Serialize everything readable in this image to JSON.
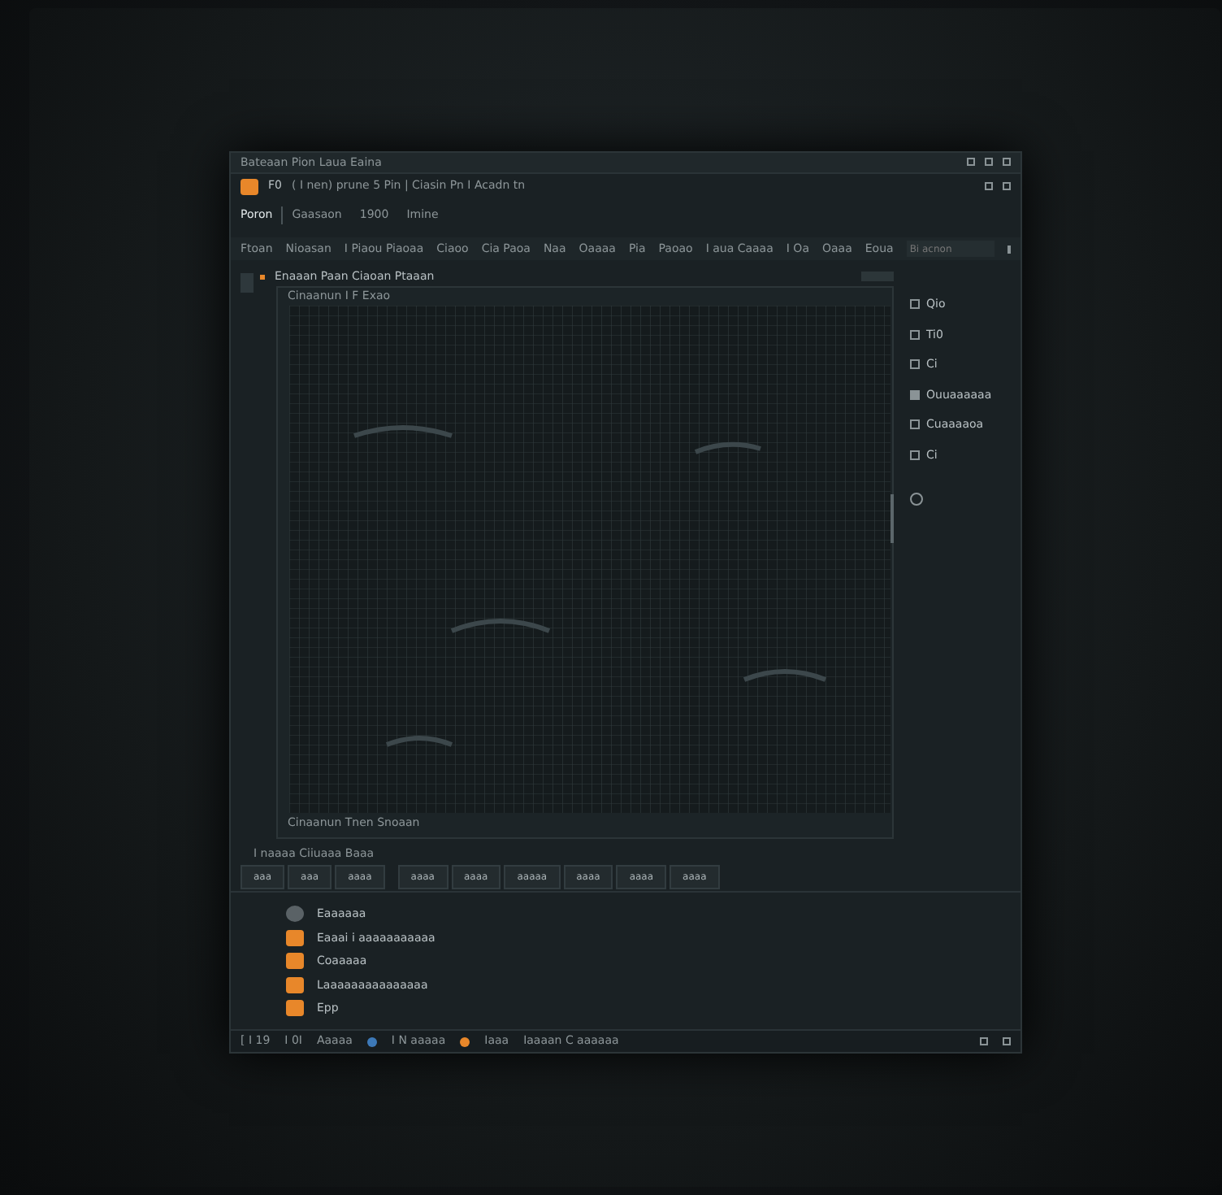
{
  "window": {
    "title": "Bateaan Pion Laua Eaina"
  },
  "toolbar": {
    "app_label": "F0",
    "path": "( I nen) prune 5 Pin | Ciasin Pn I Acadn tn"
  },
  "menu": [
    {
      "label": "Poron",
      "selected": true
    },
    {
      "label": "Gaasaon",
      "selected": false
    },
    {
      "label": "1900",
      "selected": false
    },
    {
      "label": "Imine",
      "selected": false
    }
  ],
  "filters": [
    "Ftoan",
    "Nioasan",
    "I Piaou Piaoaa",
    "Ciaoo",
    "Cia Paoa",
    "Naa",
    "Oaaaa",
    "Pia",
    "Paoao",
    "I aua Caaaa",
    "I Oa",
    "Oaaa",
    "Eoua"
  ],
  "search": {
    "placeholder": "Bi acnon"
  },
  "panel": {
    "title": "Enaaan Paan Ciaoan Ptaaan",
    "canvas_title": "Cinaanun I F Exao",
    "canvas_footer": "Cinaanun Tnen Snoaan"
  },
  "side_items": [
    {
      "label": "Qio",
      "kind": "plain"
    },
    {
      "label": "Ti0",
      "kind": "plain"
    },
    {
      "label": "Ci",
      "kind": "plain"
    },
    {
      "label": "Ouuaaaaaa",
      "kind": "filled"
    },
    {
      "label": "Cuaaaaoa",
      "kind": "plain"
    },
    {
      "label": "Ci",
      "kind": "plain"
    }
  ],
  "section_label": "I naaaa Ciiuaaa Baaa",
  "buttons": [
    "aaa",
    "aaa",
    "aaaa",
    "aaaa",
    "aaaa",
    "aaaaa",
    "aaaa",
    "aaaa",
    "aaaa"
  ],
  "legend": [
    {
      "label": "Eaaaaaa",
      "kind": "circle",
      "color": "#5a6266"
    },
    {
      "label": "Eaaai i aaaaaaaaaaa",
      "kind": "square",
      "color": "#e8872a"
    },
    {
      "label": "Coaaaaa",
      "kind": "square",
      "color": "#e8872a"
    },
    {
      "label": "Laaaaaaaaaaaaaaa",
      "kind": "square",
      "color": "#e8872a"
    },
    {
      "label": "Epp",
      "kind": "square",
      "color": "#e8872a"
    }
  ],
  "status": [
    {
      "label": "[ I 19",
      "kind": "text"
    },
    {
      "label": "I 0I",
      "kind": "text"
    },
    {
      "label": "Aaaaa",
      "kind": "text"
    },
    {
      "label": "I N aaaaa",
      "kind": "blue"
    },
    {
      "label": "Iaaa",
      "kind": "orange"
    },
    {
      "label": "Iaaaan C aaaaaa",
      "kind": "text"
    }
  ]
}
